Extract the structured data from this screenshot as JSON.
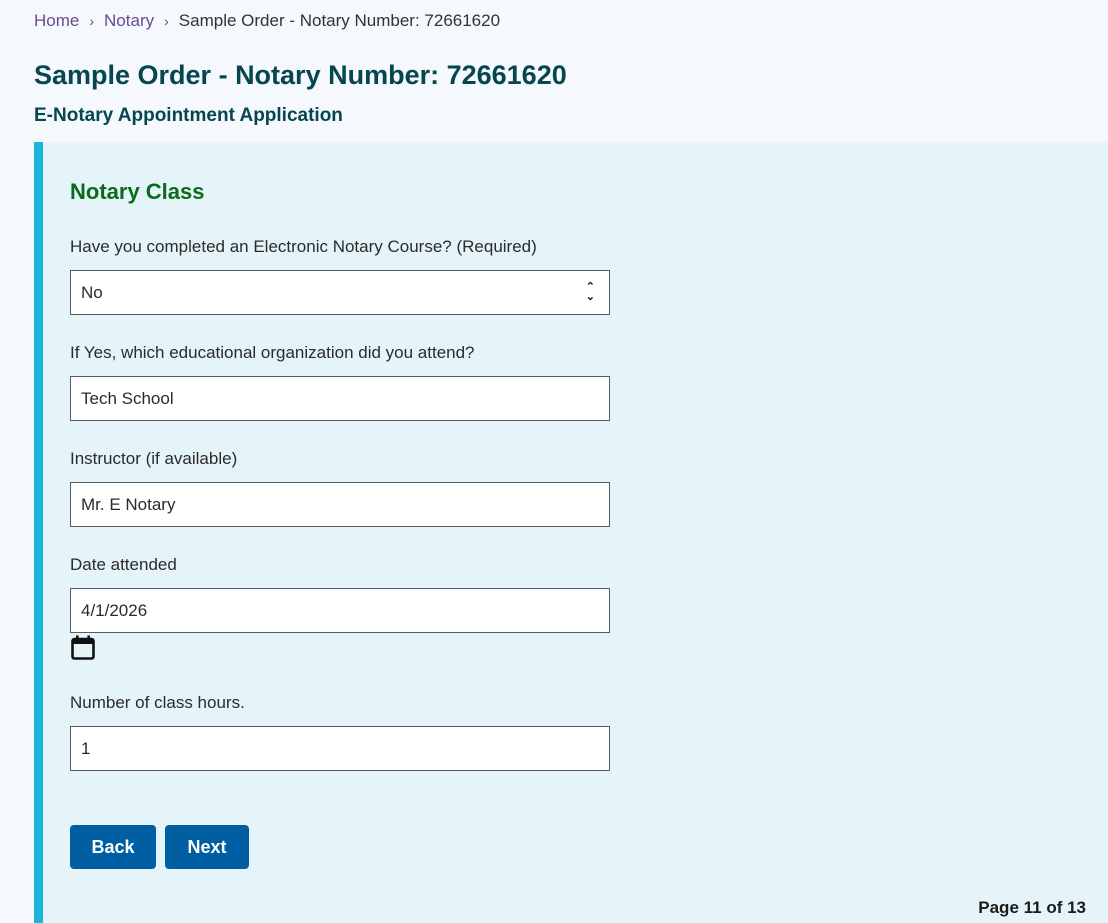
{
  "breadcrumb": {
    "items": [
      {
        "label": "Home"
      },
      {
        "label": "Notary"
      }
    ],
    "current": "Sample Order - Notary Number: 72661620",
    "separator": "›"
  },
  "header": {
    "title": "Sample Order - Notary Number: 72661620",
    "subtitle": "E-Notary Appointment Application"
  },
  "form": {
    "section_title": "Notary Class",
    "fields": [
      {
        "label": "Have you completed an Electronic Notary Course? (Required)",
        "value": "No",
        "type": "select"
      },
      {
        "label": "If Yes, which educational organization did you attend?",
        "value": "Tech School",
        "type": "text"
      },
      {
        "label": "Instructor (if available)",
        "value": "Mr. E Notary",
        "type": "text"
      },
      {
        "label": "Date attended",
        "value": "4/1/2026",
        "type": "date"
      },
      {
        "label": "Number of class hours.",
        "value": "1",
        "type": "text"
      }
    ],
    "date_picker_icon": "calendar-icon",
    "select_icon": "up-down-chevron-icon",
    "buttons": {
      "back": "Back",
      "next": "Next"
    },
    "page_indicator": "Page 11 of 13"
  },
  "colors": {
    "accent_bar": "#1ab6d9",
    "panel_bg": "#e5f4f9",
    "button_bg": "#005ea2",
    "title": "#06474f",
    "section_title": "#0b6b1a",
    "link": "#6b4a8f"
  }
}
